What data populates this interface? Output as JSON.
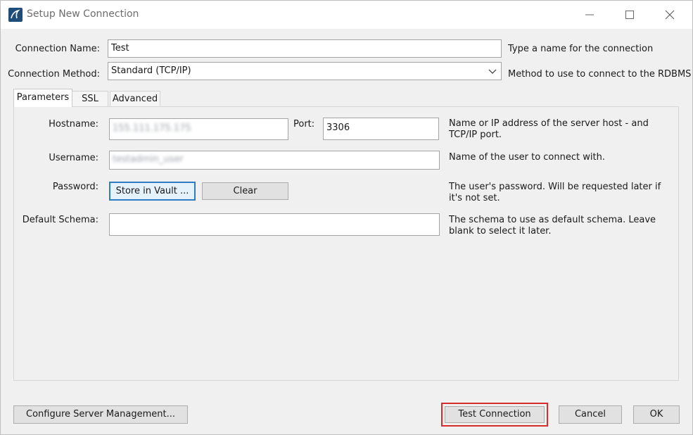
{
  "window": {
    "title": "Setup New Connection"
  },
  "form": {
    "connection_name_label": "Connection Name:",
    "connection_name_value": "Test",
    "connection_name_help": "Type a name for the connection",
    "connection_method_label": "Connection Method:",
    "connection_method_value": "Standard (TCP/IP)",
    "connection_method_help": "Method to use to connect to the RDBMS"
  },
  "tabs": [
    {
      "label": "Parameters",
      "active": true
    },
    {
      "label": "SSL",
      "active": false
    },
    {
      "label": "Advanced",
      "active": false
    }
  ],
  "parameters": {
    "hostname_label": "Hostname:",
    "hostname_value": "155.111.175.175",
    "port_label": "Port:",
    "port_value": "3306",
    "hostname_help": "Name or IP address of the server host - and TCP/IP port.",
    "username_label": "Username:",
    "username_value": "testadmin_user",
    "username_help": "Name of the user to connect with.",
    "password_label": "Password:",
    "store_in_vault_label": "Store in Vault ...",
    "clear_label": "Clear",
    "password_help": "The user's password. Will be requested later if it's not set.",
    "default_schema_label": "Default Schema:",
    "default_schema_value": "",
    "default_schema_help": "The schema to use as default schema. Leave blank to select it later."
  },
  "footer": {
    "configure_server_label": "Configure Server Management...",
    "test_connection_label": "Test Connection",
    "cancel_label": "Cancel",
    "ok_label": "OK"
  },
  "colors": {
    "highlight": "#d62c2c",
    "focus_border": "#2d7dc4"
  }
}
